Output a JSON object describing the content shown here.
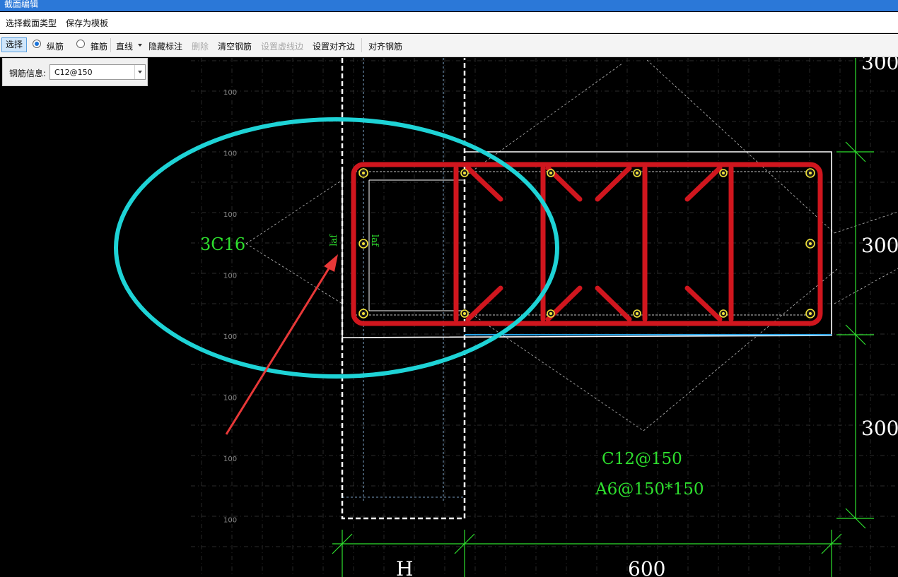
{
  "window": {
    "title": "截面编辑"
  },
  "menu": {
    "select_section_type": "选择截面类型",
    "save_as_template": "保存为模板"
  },
  "toolbar": {
    "select": "选择",
    "longitudinal": "纵筋",
    "stirrup": "箍筋",
    "line_mode": "直线",
    "hide_annotation": "隐藏标注",
    "delete": "删除",
    "clear_rebar": "清空钢筋",
    "set_dashed_edge": "设置虚线边",
    "set_align_edge": "设置对齐边",
    "align_rebar": "对齐钢筋"
  },
  "rebar_info": {
    "label": "钢筋信息:",
    "value": "C12@150"
  },
  "drawing": {
    "grid_labels": [
      "100",
      "100",
      "100",
      "100",
      "100",
      "100",
      "100",
      "100"
    ],
    "callout_left": "3C16",
    "laf_label": "laf",
    "note_rebar": "C12@150",
    "note_stirrup": "A6@150*150",
    "dim_right": [
      "300",
      "300",
      "300"
    ],
    "dim_bottom_left": "H",
    "dim_bottom_right": "600",
    "colors": {
      "rebar": "#d0161e",
      "dim": "#2ee02e",
      "highlight": "#1ed3d6",
      "arrow": "#e83838",
      "label": "#2ee02e"
    }
  }
}
